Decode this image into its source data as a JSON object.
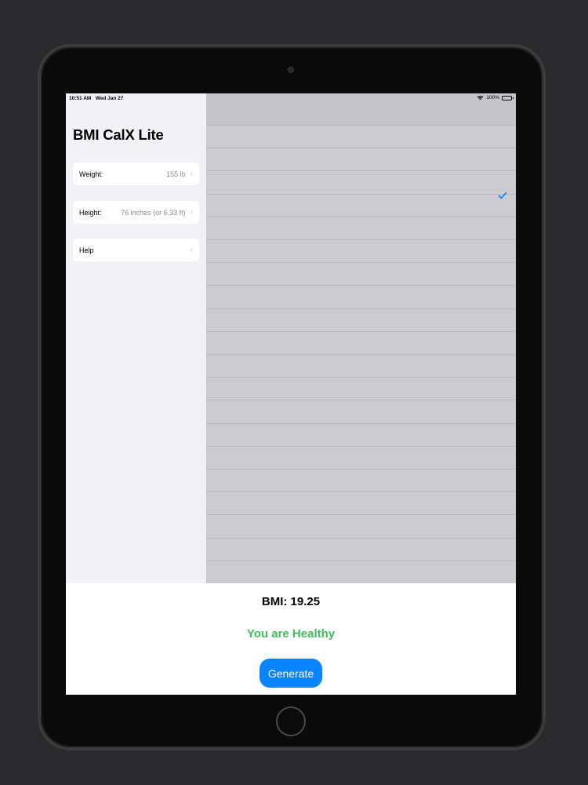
{
  "status_bar": {
    "time": "10:51 AM",
    "date": "Wed Jan 27",
    "battery": "100%"
  },
  "sidebar": {
    "title": "BMI CalX Lite",
    "items": [
      {
        "label": "Weight:",
        "value": "155 lb"
      },
      {
        "label": "Height:",
        "value": "76 inches (or 6.33 ft)"
      },
      {
        "label": "Help",
        "value": ""
      }
    ]
  },
  "result": {
    "bmi_text": "BMI: 19.25",
    "status_text": "You are Healthy",
    "generate_label": "Generate"
  },
  "colors": {
    "accent": "#0a84ff",
    "healthy": "#3cbf5a",
    "sidebar_bg": "#f2f1f6",
    "detail_bg": "#ccccd0"
  }
}
